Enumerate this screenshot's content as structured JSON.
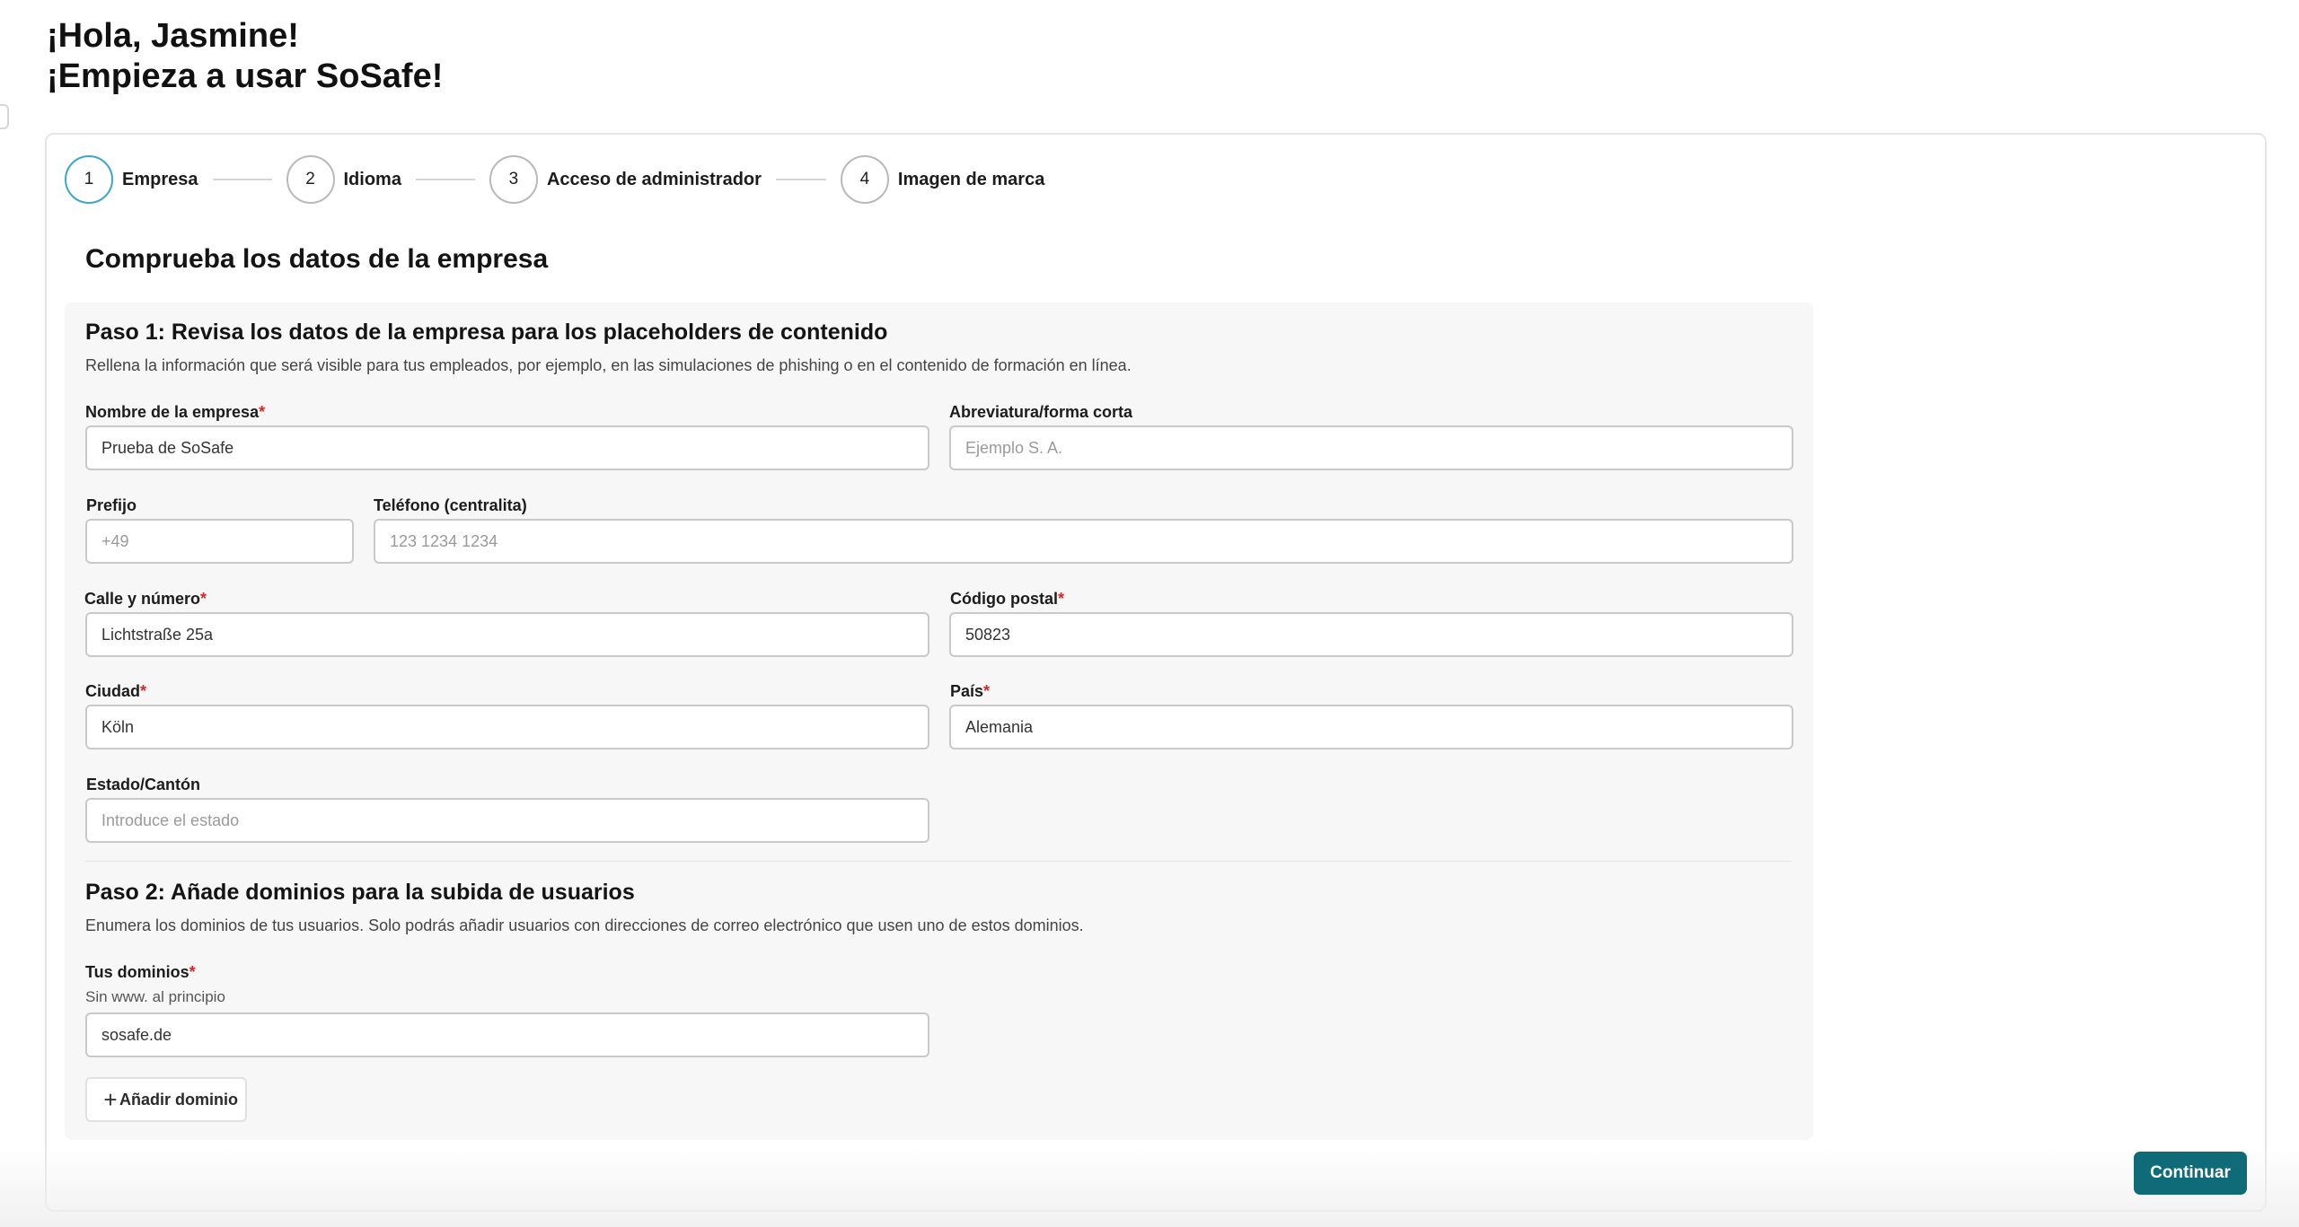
{
  "greeting": {
    "line1": "¡Hola, Jasmine!",
    "line2": "¡Empieza a usar SoSafe!"
  },
  "stepper": {
    "steps": [
      {
        "number": "1",
        "label": "Empresa",
        "active": true
      },
      {
        "number": "2",
        "label": "Idioma",
        "active": false
      },
      {
        "number": "3",
        "label": "Acceso de administrador",
        "active": false
      },
      {
        "number": "4",
        "label": "Imagen de marca",
        "active": false
      }
    ]
  },
  "page_title": "Comprueba los datos de la empresa",
  "step1": {
    "title": "Paso 1: Revisa los datos de la empresa para los placeholders de contenido",
    "description": "Rellena la información que será visible para tus empleados, por ejemplo, en las simulaciones de phishing o en el contenido de formación en línea.",
    "fields": {
      "company_name": {
        "label": "Nombre de la empresa",
        "required_mark": "*",
        "value": "Prueba de SoSafe",
        "placeholder": ""
      },
      "abbreviation": {
        "label": "Abreviatura/forma corta",
        "value": "",
        "placeholder": "Ejemplo S. A."
      },
      "prefix": {
        "label": "Prefijo",
        "value": "",
        "placeholder": "+49"
      },
      "phone": {
        "label": "Teléfono (centralita)",
        "value": "",
        "placeholder": "123 1234 1234"
      },
      "street": {
        "label": "Calle y número",
        "required_mark": "*",
        "value": "Lichtstraße 25a",
        "placeholder": ""
      },
      "postal_code": {
        "label": "Código postal",
        "required_mark": "*",
        "value": "50823",
        "placeholder": ""
      },
      "city": {
        "label": "Ciudad",
        "required_mark": "*",
        "value": "Köln",
        "placeholder": ""
      },
      "country": {
        "label": "País",
        "required_mark": "*",
        "value": "Alemania",
        "placeholder": ""
      },
      "state": {
        "label": "Estado/Cantón",
        "value": "",
        "placeholder": "Introduce el estado"
      }
    }
  },
  "step2": {
    "title": "Paso 2: Añade dominios para la subida de usuarios",
    "description": "Enumera los dominios de tus usuarios. Solo podrás añadir usuarios con direcciones de correo electrónico que usen uno de estos dominios.",
    "domains": {
      "label": "Tus dominios",
      "required_mark": "*",
      "hint": "Sin www. al principio",
      "value": "sosafe.de"
    },
    "add_button_label": "Añadir dominio",
    "add_button_icon": "plus-icon"
  },
  "continue_label": "Continuar",
  "colors": {
    "primary_button": "#0f6b78",
    "active_step_ring": "#3aa7c4",
    "required_mark": "#d62828"
  }
}
